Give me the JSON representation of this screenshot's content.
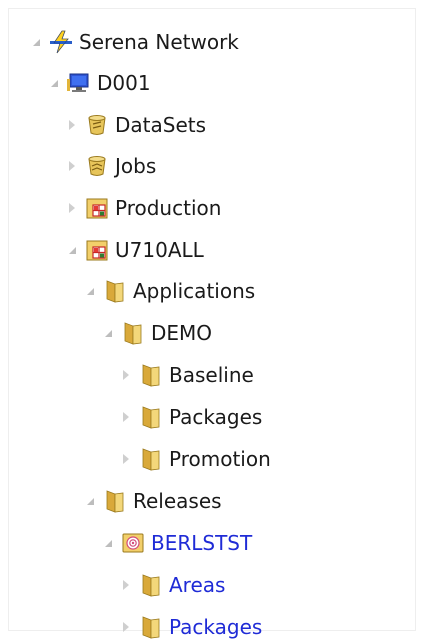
{
  "tree": {
    "nodes": [
      {
        "label": "Serena Network",
        "icon": "network-lightning-icon",
        "state": "expanded"
      },
      {
        "label": "D001",
        "icon": "computer-icon",
        "state": "expanded"
      },
      {
        "label": "DataSets",
        "icon": "dataset-bucket-icon",
        "state": "collapsed"
      },
      {
        "label": "Jobs",
        "icon": "jobs-bucket-icon",
        "state": "collapsed"
      },
      {
        "label": "Production",
        "icon": "stage-grid-icon",
        "state": "collapsed"
      },
      {
        "label": "U710ALL",
        "icon": "stage-grid-icon",
        "state": "expanded"
      },
      {
        "label": "Applications",
        "icon": "folder-icon",
        "state": "expanded"
      },
      {
        "label": "DEMO",
        "icon": "folder-icon",
        "state": "expanded"
      },
      {
        "label": "Baseline",
        "icon": "folder-icon",
        "state": "collapsed"
      },
      {
        "label": "Packages",
        "icon": "folder-icon",
        "state": "collapsed"
      },
      {
        "label": "Promotion",
        "icon": "folder-icon",
        "state": "collapsed"
      },
      {
        "label": "Releases",
        "icon": "folder-icon",
        "state": "expanded"
      },
      {
        "label": "BERLSTST",
        "icon": "release-target-icon",
        "state": "expanded",
        "color": "#1f2bd6"
      },
      {
        "label": "Areas",
        "icon": "folder-icon",
        "state": "collapsed",
        "color": "#1f2bd6"
      },
      {
        "label": "Packages",
        "icon": "folder-icon",
        "state": "collapsed",
        "color": "#1f2bd6"
      }
    ]
  },
  "colors": {
    "text": "#1a1a1a",
    "highlight_text": "#1f2bd6",
    "folder": "#e9c46a",
    "expander": "#bdbdbd"
  }
}
